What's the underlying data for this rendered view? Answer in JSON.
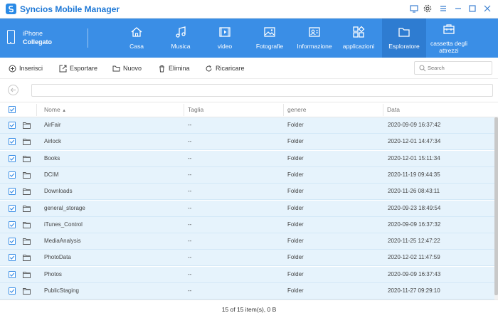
{
  "app": {
    "title": "Syncios Mobile Manager"
  },
  "device": {
    "name": "iPhone",
    "status": "Collegato"
  },
  "nav": [
    {
      "label": "Casa",
      "icon": "home-icon"
    },
    {
      "label": "Musica",
      "icon": "music-icon"
    },
    {
      "label": "video",
      "icon": "video-icon"
    },
    {
      "label": "Fotografie",
      "icon": "photo-icon"
    },
    {
      "label": "Informazione",
      "icon": "contacts-icon"
    },
    {
      "label": "applicazioni",
      "icon": "apps-icon"
    },
    {
      "label": "Esploratore",
      "icon": "folder-icon",
      "active": true
    },
    {
      "label": "cassetta degli attrezzi",
      "icon": "toolbox-icon"
    }
  ],
  "toolbar": {
    "insert": "Inserisci",
    "export": "Esportare",
    "new": "Nuovo",
    "delete": "Elimina",
    "reload": "Ricaricare"
  },
  "search": {
    "placeholder": "Search"
  },
  "table": {
    "columns": {
      "name": "Nome",
      "size": "Taglia",
      "kind": "genere",
      "date": "Data"
    },
    "rows": [
      {
        "name": "AirFair",
        "size": "--",
        "kind": "Folder",
        "date": "2020-09-09 16:37:42"
      },
      {
        "name": "Airlock",
        "size": "--",
        "kind": "Folder",
        "date": "2020-12-01 14:47:34"
      },
      {
        "name": "Books",
        "size": "--",
        "kind": "Folder",
        "date": "2020-12-01 15:11:34"
      },
      {
        "name": "DCIM",
        "size": "--",
        "kind": "Folder",
        "date": "2020-11-19 09:44:35"
      },
      {
        "name": "Downloads",
        "size": "--",
        "kind": "Folder",
        "date": "2020-11-26 08:43:11"
      },
      {
        "name": "general_storage",
        "size": "--",
        "kind": "Folder",
        "date": "2020-09-23 18:49:54"
      },
      {
        "name": "iTunes_Control",
        "size": "--",
        "kind": "Folder",
        "date": "2020-09-09 16:37:32"
      },
      {
        "name": "MediaAnalysis",
        "size": "--",
        "kind": "Folder",
        "date": "2020-11-25 12:47:22"
      },
      {
        "name": "PhotoData",
        "size": "--",
        "kind": "Folder",
        "date": "2020-12-02 11:47:59"
      },
      {
        "name": "Photos",
        "size": "--",
        "kind": "Folder",
        "date": "2020-09-09 16:37:43"
      },
      {
        "name": "PublicStaging",
        "size": "--",
        "kind": "Folder",
        "date": "2020-11-27 09:29:10"
      }
    ]
  },
  "status": {
    "summary": "15 of 15 item(s), 0 B"
  },
  "colors": {
    "accent": "#3a8ee6",
    "active_nav": "#2e7cd1",
    "row_selected": "#e6f3fc"
  }
}
